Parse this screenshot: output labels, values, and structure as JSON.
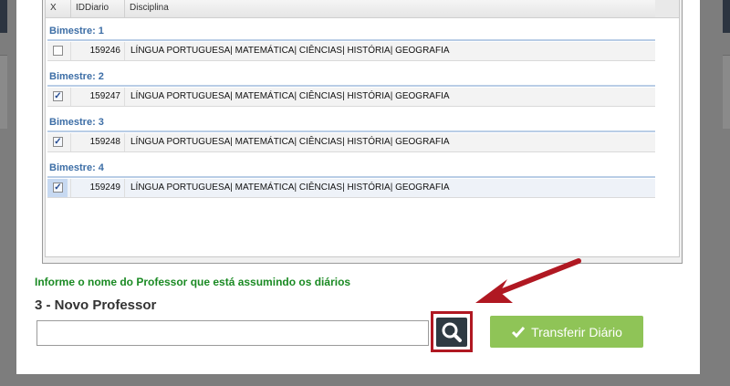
{
  "table": {
    "columns": {
      "check": "X",
      "id": "IDDiario",
      "subject": "Disciplina"
    },
    "groups": [
      {
        "title": "Bimestre: 1",
        "id": "159246",
        "subjects": "LÍNGUA PORTUGUESA| MATEMÁTICA| CIÊNCIAS| HISTÓRIA| GEOGRAFIA",
        "checked": false
      },
      {
        "title": "Bimestre: 2",
        "id": "159247",
        "subjects": "LÍNGUA PORTUGUESA| MATEMÁTICA| CIÊNCIAS| HISTÓRIA| GEOGRAFIA",
        "checked": true
      },
      {
        "title": "Bimestre: 3",
        "id": "159248",
        "subjects": "LÍNGUA PORTUGUESA| MATEMÁTICA| CIÊNCIAS| HISTÓRIA| GEOGRAFIA",
        "checked": true
      },
      {
        "title": "Bimestre: 4",
        "id": "159249",
        "subjects": "LÍNGUA PORTUGUESA| MATEMÁTICA| CIÊNCIAS| HISTÓRIA| GEOGRAFIA",
        "checked": true
      }
    ]
  },
  "form": {
    "instruction": "Informe o nome do Professor que está assumindo os diários",
    "section_title": "3 - Novo Professor",
    "professor_value": "",
    "search_icon": "search-icon",
    "transfer_label": "Transferir Diário",
    "transfer_icon": "checkmark-icon"
  },
  "colors": {
    "group_title": "#3d6ea6",
    "instruction": "#1a8a23",
    "search_button": "#2e3a42",
    "transfer_button": "#8fc457",
    "annotation": "#b01822"
  }
}
